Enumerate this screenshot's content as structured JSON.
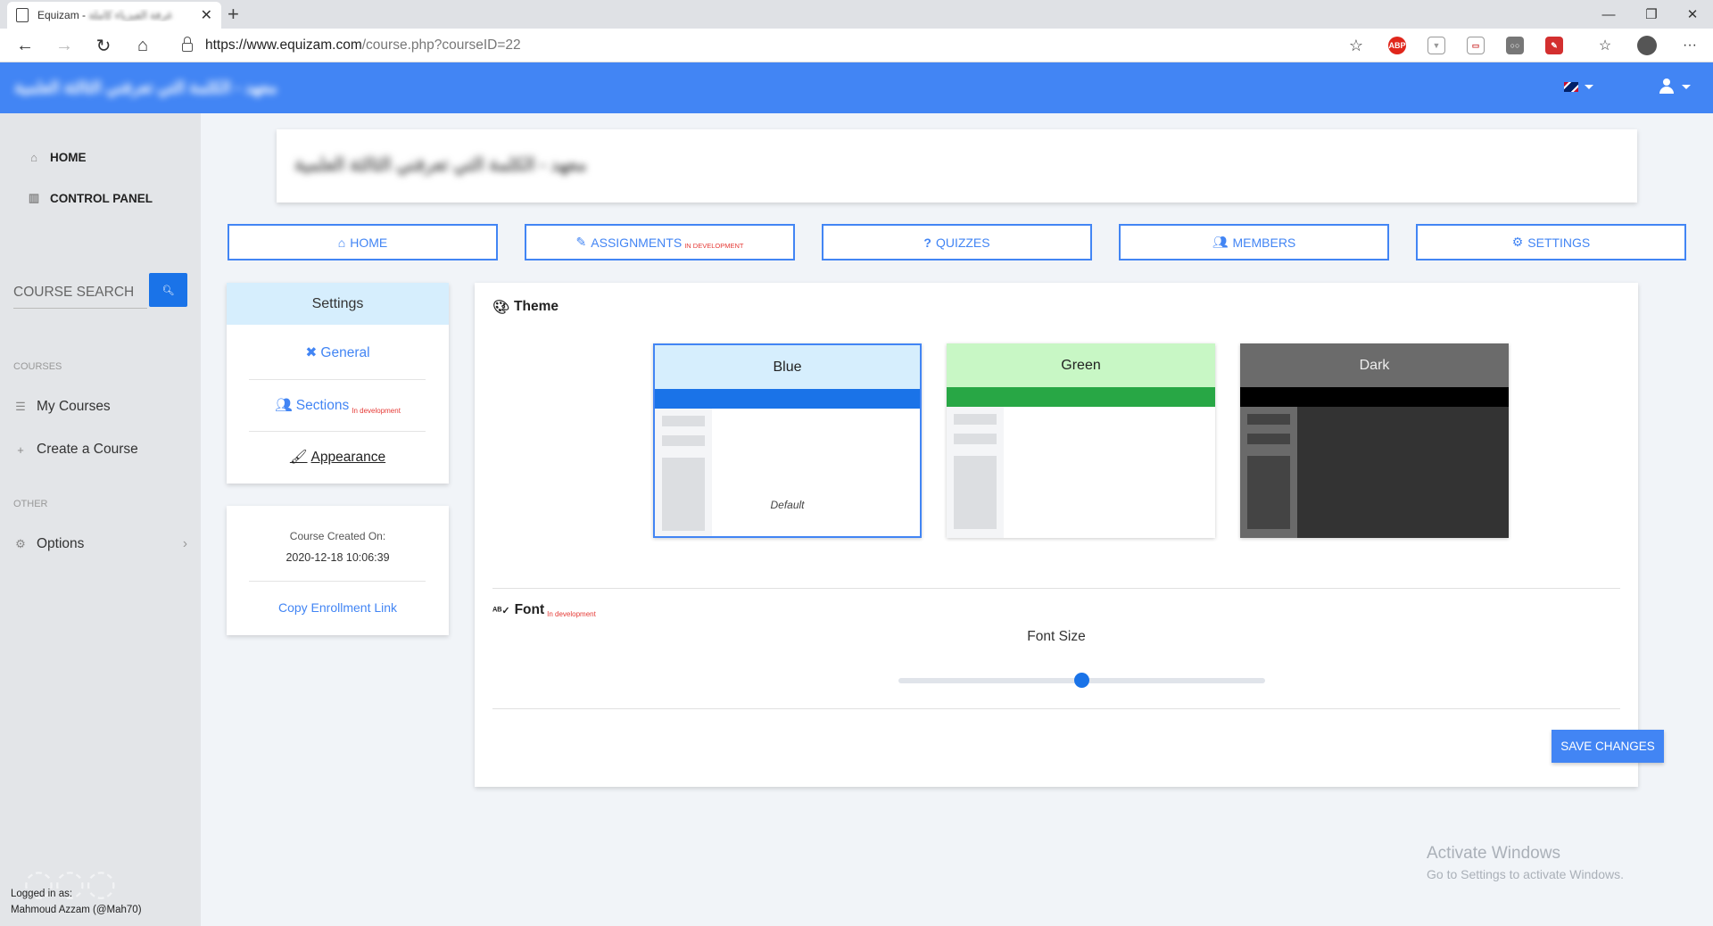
{
  "browser": {
    "tab_title": "Equizam - ",
    "tab_title_obscured": "غرفة الفيزياء كاملة",
    "tab_close": "✕",
    "new_tab": "+",
    "url_host": "https://www.equizam.com",
    "url_path": "/course.php?courseID=22",
    "window_minimize": "—",
    "window_restore": "❐",
    "window_close": "✕",
    "more_menu": "···"
  },
  "header": {
    "brand_obscured": "معهد - الكلمة التي تعرفني الثالثة العلمية",
    "lang_flag": "uk-flag-icon",
    "user_menu": "user-icon"
  },
  "sidebar": {
    "nav": [
      {
        "label": "HOME",
        "icon": "home-icon"
      },
      {
        "label": "CONTROL PANEL",
        "icon": "columns-icon"
      }
    ],
    "search_placeholder": "COURSE SEARCH",
    "courses_heading": "COURSES",
    "courses_items": [
      {
        "label": "My Courses",
        "icon": "list-icon"
      },
      {
        "label": "Create a Course",
        "icon": "plus-icon"
      }
    ],
    "other_heading": "OTHER",
    "options_label": "Options",
    "logged_in_label": "Logged in as:",
    "logged_in_user": "Mahmoud Azzam (@Mah70)"
  },
  "course": {
    "title_obscured": "معهد - الكلمة التي تعرفني الثالثة العلمية"
  },
  "course_nav": [
    {
      "label": "HOME",
      "icon": "home-icon",
      "note": ""
    },
    {
      "label": "ASSIGNMENTS",
      "icon": "pencil-icon",
      "note": "IN DEVELOPMENT"
    },
    {
      "label": "QUIZZES",
      "icon": "question-icon",
      "note": ""
    },
    {
      "label": "MEMBERS",
      "icon": "users-icon",
      "note": ""
    },
    {
      "label": "SETTINGS",
      "icon": "gear-icon",
      "note": ""
    }
  ],
  "settings_menu": {
    "header": "Settings",
    "items": [
      {
        "label": "General",
        "icon": "tools-icon",
        "note": ""
      },
      {
        "label": "Sections",
        "icon": "users-icon",
        "note": "In development"
      },
      {
        "label": "Appearance",
        "icon": "brush-icon",
        "note": ""
      }
    ]
  },
  "course_info": {
    "created_label": "Course Created On:",
    "created_value": "2020-12-18 10:06:39",
    "copy_link": "Copy Enrollment Link"
  },
  "appearance": {
    "theme_title": "Theme",
    "themes": [
      {
        "name": "Blue",
        "header_color": "#d6eefd",
        "bar_color": "#1a73e8",
        "selected": true,
        "note": "Default"
      },
      {
        "name": "Green",
        "header_color": "#c8f7c5",
        "bar_color": "#28a745",
        "selected": false,
        "note": ""
      },
      {
        "name": "Dark",
        "header_color": "#6b6b6b",
        "bar_color": "#000000",
        "selected": false,
        "note": ""
      }
    ],
    "font_title": "Font",
    "font_note": "In development",
    "font_size_label": "Font Size",
    "font_size_value": 0.5,
    "save_label": "SAVE CHANGES"
  },
  "os_overlay": {
    "activate_title": "Activate Windows",
    "activate_sub": "Go to Settings to activate Windows."
  }
}
